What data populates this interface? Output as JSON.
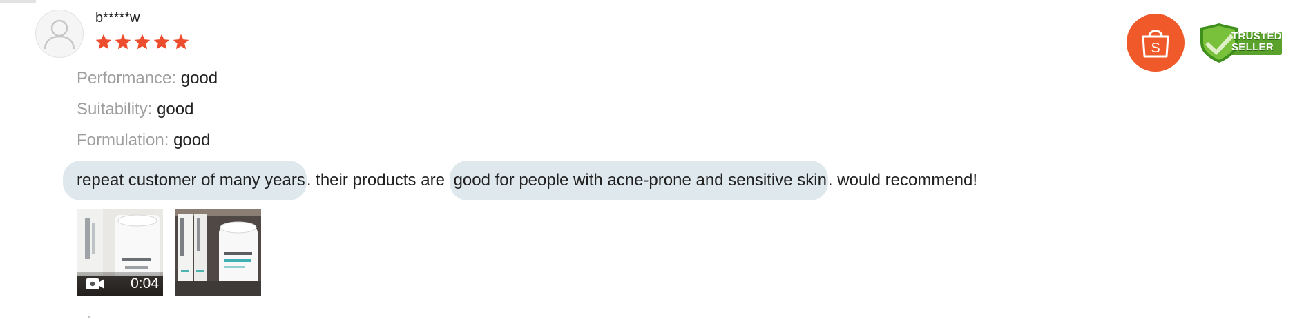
{
  "review": {
    "username": "b*****w",
    "rating": 5,
    "rating_max": 5,
    "star_color": "#ee4d2d",
    "attributes": [
      {
        "label": "Performance:",
        "value": "good"
      },
      {
        "label": "Suitability:",
        "value": "good"
      },
      {
        "label": "Formulation:",
        "value": "good"
      }
    ],
    "text": {
      "highlight_1": "repeat customer of many years",
      "plain_1": ". their products are ",
      "highlight_2": "good for people with acne-prone and sensitive skin",
      "plain_2": ". would recommend!"
    },
    "media": [
      {
        "type": "video",
        "icon": "video-camera-icon",
        "duration": "0:04"
      },
      {
        "type": "image"
      }
    ]
  },
  "badges": {
    "shop": {
      "icon": "shopping-bag-icon",
      "letter": "S",
      "color": "#f0592a"
    },
    "trusted_seller": {
      "line1": "TRUSTED",
      "line2": "SELLER",
      "icon": "shield-check-icon",
      "color": "#5aa22b"
    }
  }
}
